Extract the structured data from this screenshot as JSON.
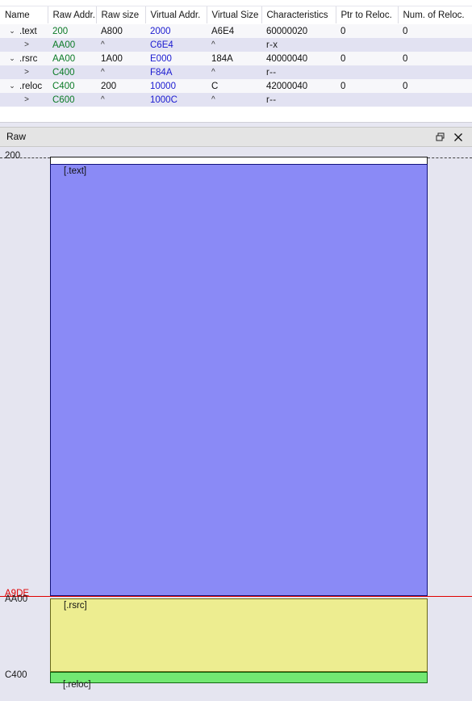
{
  "section_table": {
    "columns": [
      {
        "key": "name",
        "label": "Name"
      },
      {
        "key": "raw_addr",
        "label": "Raw Addr."
      },
      {
        "key": "raw_size",
        "label": "Raw size"
      },
      {
        "key": "virt_addr",
        "label": "Virtual Addr."
      },
      {
        "key": "virt_size",
        "label": "Virtual Size"
      },
      {
        "key": "characteristics",
        "label": "Characteristics"
      },
      {
        "key": "ptr_reloc",
        "label": "Ptr to Reloc."
      },
      {
        "key": "num_reloc",
        "label": "Num. of Reloc."
      }
    ],
    "rows": [
      {
        "kind": "parent",
        "chevron": "⌄",
        "name": ".text",
        "raw_addr": "200",
        "raw_size": "A800",
        "virt_addr": "2000",
        "virt_size": "A6E4",
        "characteristics": "60000020",
        "ptr_reloc": "0",
        "num_reloc": "0"
      },
      {
        "kind": "child",
        "chevron": ">",
        "name": "",
        "raw_addr": "AA00",
        "raw_size": "^",
        "virt_addr": "C6E4",
        "virt_size": "^",
        "characteristics": "r-x",
        "ptr_reloc": "",
        "num_reloc": ""
      },
      {
        "kind": "parent",
        "chevron": "⌄",
        "name": ".rsrc",
        "raw_addr": "AA00",
        "raw_size": "1A00",
        "virt_addr": "E000",
        "virt_size": "184A",
        "characteristics": "40000040",
        "ptr_reloc": "0",
        "num_reloc": "0"
      },
      {
        "kind": "child",
        "chevron": ">",
        "name": "",
        "raw_addr": "C400",
        "raw_size": "^",
        "virt_addr": "F84A",
        "virt_size": "^",
        "characteristics": "r--",
        "ptr_reloc": "",
        "num_reloc": ""
      },
      {
        "kind": "parent",
        "chevron": "⌄",
        "name": ".reloc",
        "raw_addr": "C400",
        "raw_size": "200",
        "virt_addr": "10000",
        "virt_size": "C",
        "characteristics": "42000040",
        "ptr_reloc": "0",
        "num_reloc": "0"
      },
      {
        "kind": "child",
        "chevron": ">",
        "name": "",
        "raw_addr": "C600",
        "raw_size": "^",
        "virt_addr": "1000C",
        "virt_size": "^",
        "characteristics": "r--",
        "ptr_reloc": "",
        "num_reloc": ""
      }
    ]
  },
  "raw_panel": {
    "title": "Raw",
    "restore_icon": "restore-window-icon",
    "close_icon": "close-icon",
    "ruler": {
      "top_offset": "200",
      "text_end_red": "A9DE",
      "rsrc_start": "AA00",
      "reloc_start": "C400"
    },
    "blocks": [
      {
        "id": "headers",
        "label": "",
        "color": "#ffffff"
      },
      {
        "id": "text",
        "label": "[.text]",
        "color": "#8a8af6"
      },
      {
        "id": "rsrc",
        "label": "[.rsrc]",
        "color": "#eded90"
      },
      {
        "id": "reloc",
        "label": "[.reloc]",
        "color": "#72e872"
      }
    ]
  },
  "colors": {
    "raw_addr_text": "#0a7a25",
    "virtual_addr_text": "#1a1ad0",
    "marker_line": "#e00000",
    "panel_background": "#e5e5f0",
    "row_stripe": "#e2e2f2"
  }
}
